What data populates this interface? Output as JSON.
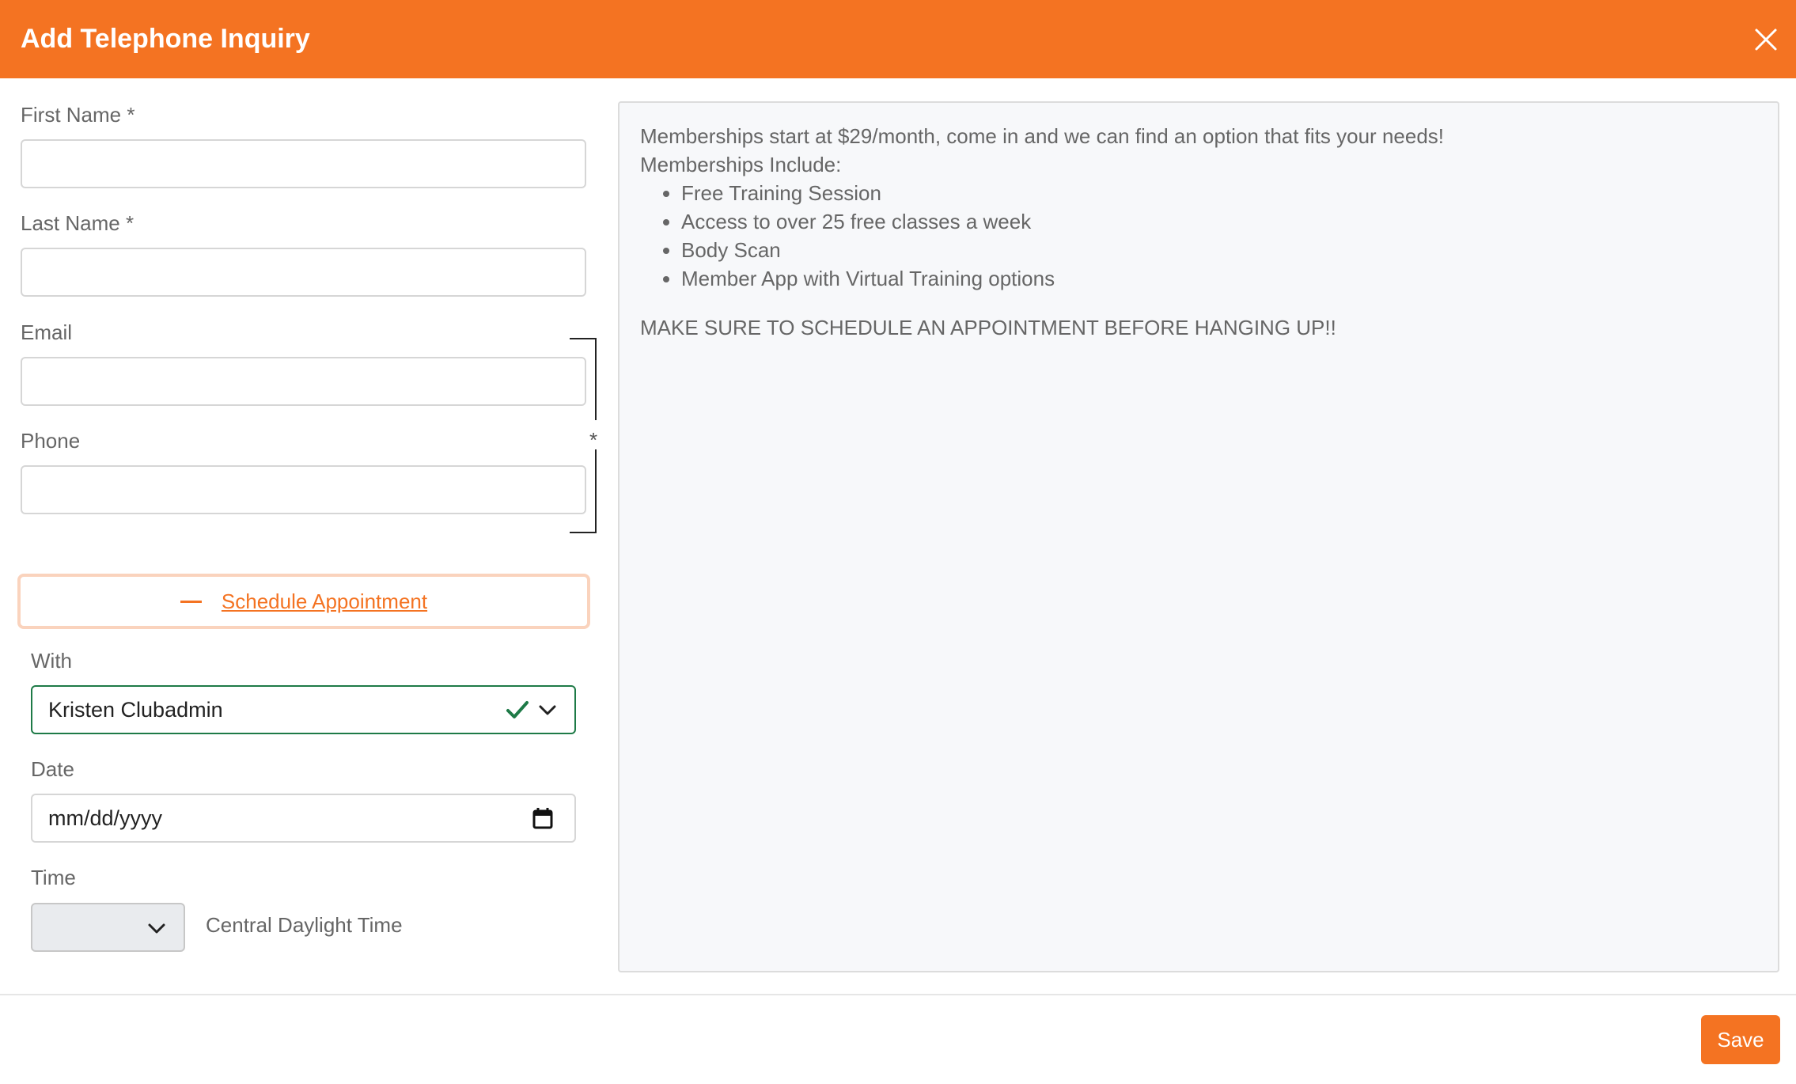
{
  "dialog": {
    "title": "Add Telephone Inquiry",
    "close_icon": "close-icon"
  },
  "form": {
    "first_name_label": "First Name *",
    "first_name_value": "",
    "last_name_label": "Last Name *",
    "last_name_value": "",
    "email_label": "Email",
    "email_value": "",
    "phone_label": "Phone",
    "phone_value": "",
    "contact_required_marker": "*"
  },
  "schedule": {
    "toggle_icon": "minus-icon",
    "toggle_label": "Schedule Appointment",
    "with_label": "With",
    "with_value": "Kristen Clubadmin",
    "date_label": "Date",
    "date_placeholder": "mm/dd/yyyy",
    "time_label": "Time",
    "time_value": "",
    "timezone": "Central Daylight Time"
  },
  "info_panel": {
    "intro": "Memberships start at $29/month, come in and we can find an option that fits your needs!",
    "list_heading": "Memberships Include:",
    "items": [
      "Free Training Session",
      "Access to over 25 free classes a week",
      "Body Scan",
      "Member App with Virtual Training options"
    ],
    "warning": "MAKE SURE TO SCHEDULE AN APPOINTMENT BEFORE HANGING UP!!"
  },
  "footer": {
    "save_label": "Save"
  },
  "colors": {
    "accent": "#f47322",
    "valid": "#1e7a47",
    "panel_bg": "#f7f8fa"
  }
}
